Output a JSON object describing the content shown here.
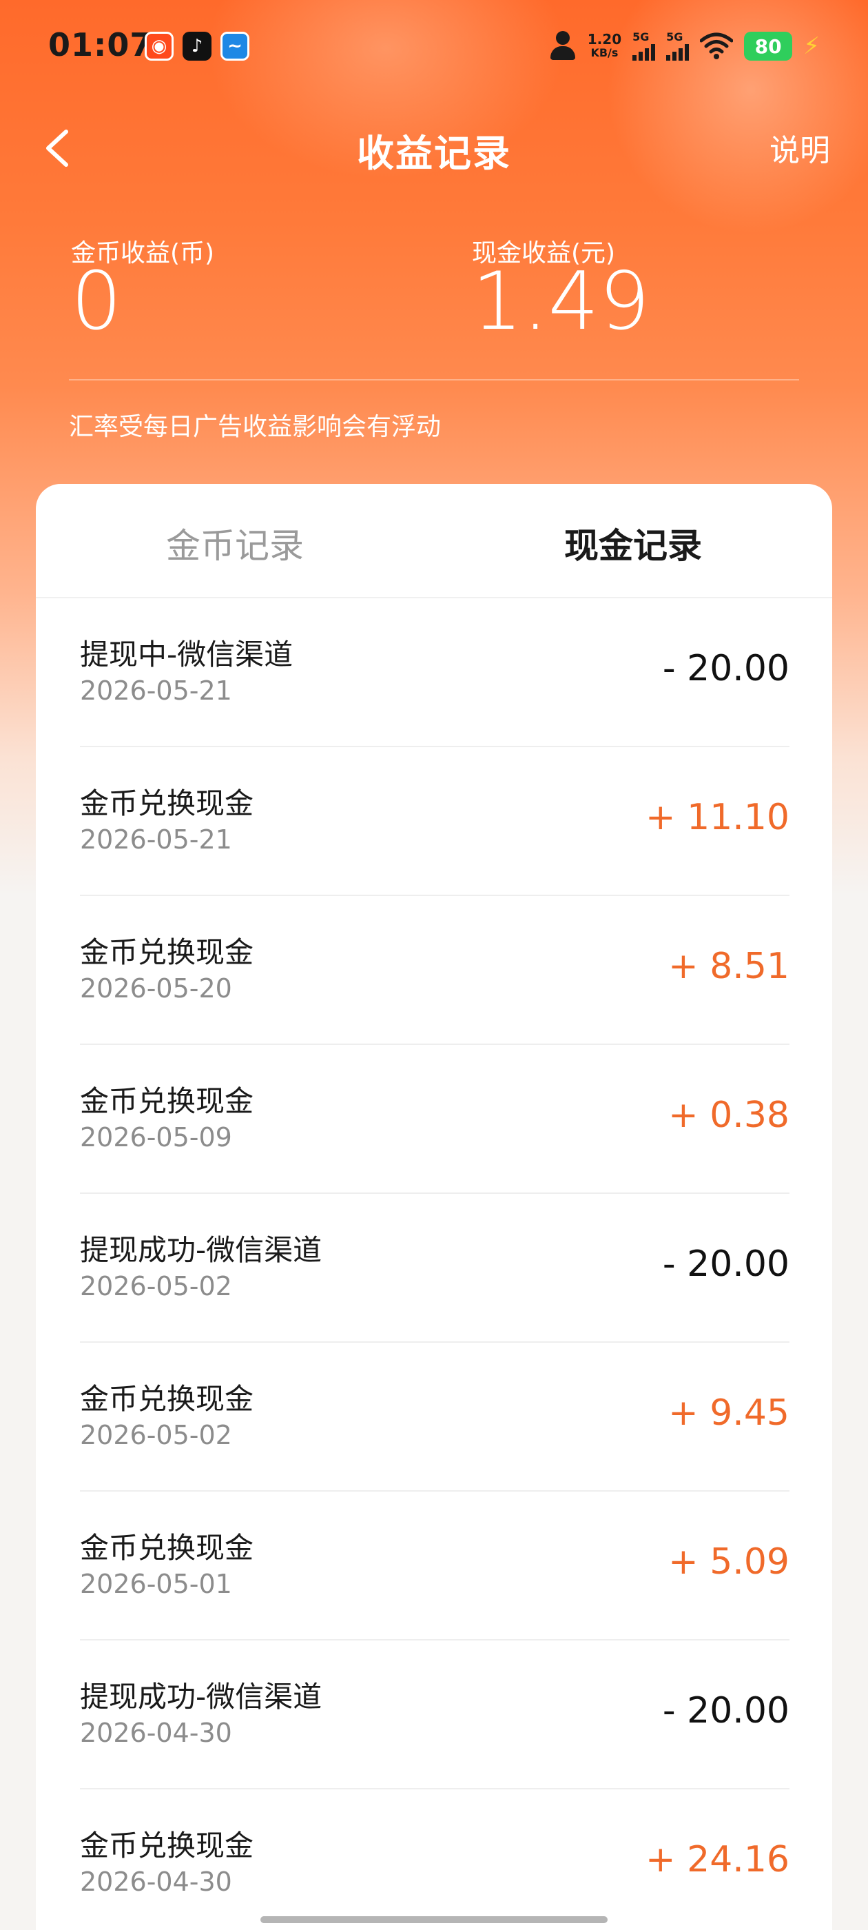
{
  "status_bar": {
    "time": "01:07",
    "app_icons": [
      "weibo-icon",
      "tiktok-icon",
      "bird-app-icon"
    ],
    "speed_value": "1.20",
    "speed_unit": "KB/s",
    "signal1_label": "5G",
    "signal2_label": "5G",
    "battery": "80"
  },
  "header": {
    "title": "收益记录",
    "explain_label": "说明"
  },
  "summary": {
    "coin_label": "金币收益(币)",
    "coin_value": "0",
    "cash_label": "现金收益(元)",
    "cash_value": "1.49",
    "note": "汇率受每日广告收益影响会有浮动"
  },
  "tabs": {
    "coin": "金币记录",
    "cash": "现金记录"
  },
  "records": [
    {
      "title": "提现中-微信渠道",
      "date": "2026-05-21",
      "amount": "- 20.00",
      "type": "negative"
    },
    {
      "title": "金币兑换现金",
      "date": "2026-05-21",
      "amount": "+ 11.10",
      "type": "positive"
    },
    {
      "title": "金币兑换现金",
      "date": "2026-05-20",
      "amount": "+ 8.51",
      "type": "positive"
    },
    {
      "title": "金币兑换现金",
      "date": "2026-05-09",
      "amount": "+ 0.38",
      "type": "positive"
    },
    {
      "title": "提现成功-微信渠道",
      "date": "2026-05-02",
      "amount": "- 20.00",
      "type": "negative"
    },
    {
      "title": "金币兑换现金",
      "date": "2026-05-02",
      "amount": "+ 9.45",
      "type": "positive"
    },
    {
      "title": "金币兑换现金",
      "date": "2026-05-01",
      "amount": "+ 5.09",
      "type": "positive"
    },
    {
      "title": "提现成功-微信渠道",
      "date": "2026-04-30",
      "amount": "- 20.00",
      "type": "negative"
    },
    {
      "title": "金币兑换现金",
      "date": "2026-04-30",
      "amount": "+ 24.16",
      "type": "positive"
    }
  ],
  "colors": {
    "accent": "#ff6a2b",
    "positive_amount": "#f06a2a",
    "negative_amount": "#111111"
  }
}
